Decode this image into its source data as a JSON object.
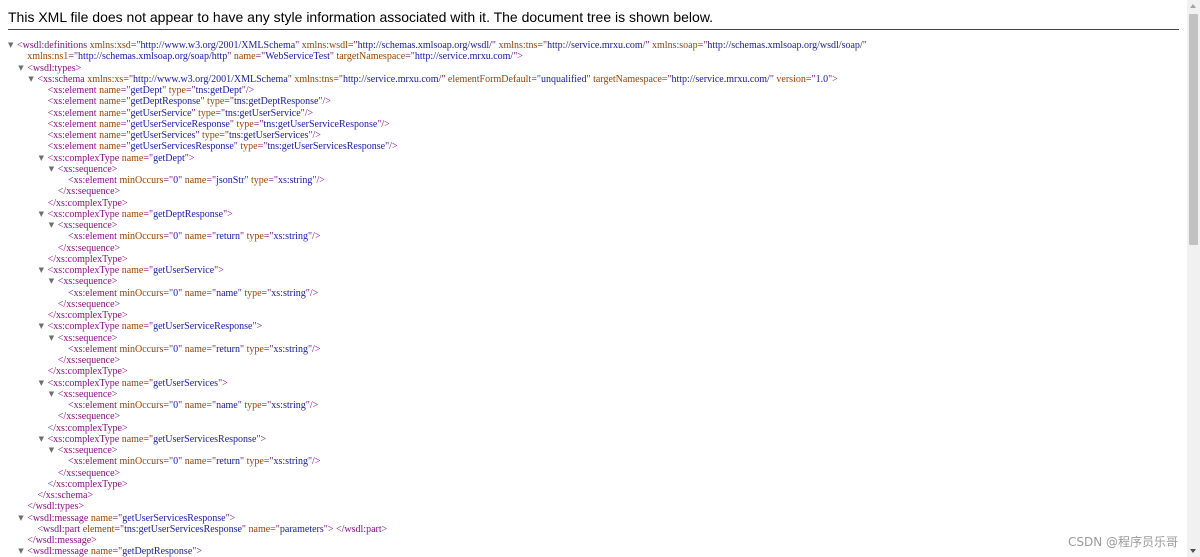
{
  "header": {
    "message": "This XML file does not appear to have any style information associated with it. The document tree is shown below."
  },
  "watermark": {
    "text": "CSDN @程序员乐哥"
  },
  "icons": {
    "expanded": "triangle-down-icon"
  },
  "lines": [
    {
      "indent": 0,
      "toggle": true,
      "parts": [
        [
          "t",
          "<wsdl:definitions "
        ],
        [
          "a",
          "xmlns:xsd"
        ],
        [
          "t",
          "=\""
        ],
        [
          "v",
          "http://www.w3.org/2001/XMLSchema"
        ],
        [
          "t",
          "\" "
        ],
        [
          "a",
          "xmlns:wsdl"
        ],
        [
          "t",
          "=\""
        ],
        [
          "v",
          "http://schemas.xmlsoap.org/wsdl/"
        ],
        [
          "t",
          "\" "
        ],
        [
          "a",
          "xmlns:tns"
        ],
        [
          "t",
          "=\""
        ],
        [
          "v",
          "http://service.mrxu.com/"
        ],
        [
          "t",
          "\" "
        ],
        [
          "a",
          "xmlns:soap"
        ],
        [
          "t",
          "=\""
        ],
        [
          "v",
          "http://schemas.xmlsoap.org/wsdl/soap/"
        ],
        [
          "t",
          "\""
        ]
      ]
    },
    {
      "indent": 1,
      "toggle": false,
      "parts": [
        [
          "a",
          "xmlns:ns1"
        ],
        [
          "t",
          "=\""
        ],
        [
          "v",
          "http://schemas.xmlsoap.org/soap/http"
        ],
        [
          "t",
          "\" "
        ],
        [
          "a",
          "name"
        ],
        [
          "t",
          "=\""
        ],
        [
          "v",
          "WebServiceTest"
        ],
        [
          "t",
          "\" "
        ],
        [
          "a",
          "targetNamespace"
        ],
        [
          "t",
          "=\""
        ],
        [
          "v",
          "http://service.mrxu.com/"
        ],
        [
          "t",
          "\">"
        ]
      ]
    },
    {
      "indent": 1,
      "toggle": true,
      "parts": [
        [
          "t",
          "<wsdl:types>"
        ]
      ]
    },
    {
      "indent": 2,
      "toggle": true,
      "parts": [
        [
          "t",
          "<xs:schema "
        ],
        [
          "a",
          "xmlns:xs"
        ],
        [
          "t",
          "=\""
        ],
        [
          "v",
          "http://www.w3.org/2001/XMLSchema"
        ],
        [
          "t",
          "\" "
        ],
        [
          "a",
          "xmlns:tns"
        ],
        [
          "t",
          "=\""
        ],
        [
          "v",
          "http://service.mrxu.com/"
        ],
        [
          "t",
          "\" "
        ],
        [
          "a",
          "elementFormDefault"
        ],
        [
          "t",
          "=\""
        ],
        [
          "v",
          "unqualified"
        ],
        [
          "t",
          "\" "
        ],
        [
          "a",
          "targetNamespace"
        ],
        [
          "t",
          "=\""
        ],
        [
          "v",
          "http://service.mrxu.com/"
        ],
        [
          "t",
          "\" "
        ],
        [
          "a",
          "version"
        ],
        [
          "t",
          "=\""
        ],
        [
          "v",
          "1.0"
        ],
        [
          "t",
          "\">"
        ]
      ]
    },
    {
      "indent": 3,
      "toggle": false,
      "parts": [
        [
          "t",
          "<xs:element "
        ],
        [
          "a",
          "name"
        ],
        [
          "t",
          "=\""
        ],
        [
          "v",
          "getDept"
        ],
        [
          "t",
          "\" "
        ],
        [
          "a",
          "type"
        ],
        [
          "t",
          "=\""
        ],
        [
          "v",
          "tns:getDept"
        ],
        [
          "t",
          "\"/>"
        ]
      ]
    },
    {
      "indent": 3,
      "toggle": false,
      "parts": [
        [
          "t",
          "<xs:element "
        ],
        [
          "a",
          "name"
        ],
        [
          "t",
          "=\""
        ],
        [
          "v",
          "getDeptResponse"
        ],
        [
          "t",
          "\" "
        ],
        [
          "a",
          "type"
        ],
        [
          "t",
          "=\""
        ],
        [
          "v",
          "tns:getDeptResponse"
        ],
        [
          "t",
          "\"/>"
        ]
      ]
    },
    {
      "indent": 3,
      "toggle": false,
      "parts": [
        [
          "t",
          "<xs:element "
        ],
        [
          "a",
          "name"
        ],
        [
          "t",
          "=\""
        ],
        [
          "v",
          "getUserService"
        ],
        [
          "t",
          "\" "
        ],
        [
          "a",
          "type"
        ],
        [
          "t",
          "=\""
        ],
        [
          "v",
          "tns:getUserService"
        ],
        [
          "t",
          "\"/>"
        ]
      ]
    },
    {
      "indent": 3,
      "toggle": false,
      "parts": [
        [
          "t",
          "<xs:element "
        ],
        [
          "a",
          "name"
        ],
        [
          "t",
          "=\""
        ],
        [
          "v",
          "getUserServiceResponse"
        ],
        [
          "t",
          "\" "
        ],
        [
          "a",
          "type"
        ],
        [
          "t",
          "=\""
        ],
        [
          "v",
          "tns:getUserServiceResponse"
        ],
        [
          "t",
          "\"/>"
        ]
      ]
    },
    {
      "indent": 3,
      "toggle": false,
      "parts": [
        [
          "t",
          "<xs:element "
        ],
        [
          "a",
          "name"
        ],
        [
          "t",
          "=\""
        ],
        [
          "v",
          "getUserServices"
        ],
        [
          "t",
          "\" "
        ],
        [
          "a",
          "type"
        ],
        [
          "t",
          "=\""
        ],
        [
          "v",
          "tns:getUserServices"
        ],
        [
          "t",
          "\"/>"
        ]
      ]
    },
    {
      "indent": 3,
      "toggle": false,
      "parts": [
        [
          "t",
          "<xs:element "
        ],
        [
          "a",
          "name"
        ],
        [
          "t",
          "=\""
        ],
        [
          "v",
          "getUserServicesResponse"
        ],
        [
          "t",
          "\" "
        ],
        [
          "a",
          "type"
        ],
        [
          "t",
          "=\""
        ],
        [
          "v",
          "tns:getUserServicesResponse"
        ],
        [
          "t",
          "\"/>"
        ]
      ]
    },
    {
      "indent": 3,
      "toggle": true,
      "parts": [
        [
          "t",
          "<xs:complexType "
        ],
        [
          "a",
          "name"
        ],
        [
          "t",
          "=\""
        ],
        [
          "v",
          "getDept"
        ],
        [
          "t",
          "\">"
        ]
      ]
    },
    {
      "indent": 4,
      "toggle": true,
      "parts": [
        [
          "t",
          "<xs:sequence>"
        ]
      ]
    },
    {
      "indent": 5,
      "toggle": false,
      "parts": [
        [
          "t",
          "<xs:element "
        ],
        [
          "a",
          "minOccurs"
        ],
        [
          "t",
          "=\""
        ],
        [
          "v",
          "0"
        ],
        [
          "t",
          "\" "
        ],
        [
          "a",
          "name"
        ],
        [
          "t",
          "=\""
        ],
        [
          "v",
          "jsonStr"
        ],
        [
          "t",
          "\" "
        ],
        [
          "a",
          "type"
        ],
        [
          "t",
          "=\""
        ],
        [
          "v",
          "xs:string"
        ],
        [
          "t",
          "\"/>"
        ]
      ]
    },
    {
      "indent": 4,
      "toggle": false,
      "parts": [
        [
          "t",
          "</xs:sequence>"
        ]
      ]
    },
    {
      "indent": 3,
      "toggle": false,
      "parts": [
        [
          "t",
          "</xs:complexType>"
        ]
      ]
    },
    {
      "indent": 3,
      "toggle": true,
      "parts": [
        [
          "t",
          "<xs:complexType "
        ],
        [
          "a",
          "name"
        ],
        [
          "t",
          "=\""
        ],
        [
          "v",
          "getDeptResponse"
        ],
        [
          "t",
          "\">"
        ]
      ]
    },
    {
      "indent": 4,
      "toggle": true,
      "parts": [
        [
          "t",
          "<xs:sequence>"
        ]
      ]
    },
    {
      "indent": 5,
      "toggle": false,
      "parts": [
        [
          "t",
          "<xs:element "
        ],
        [
          "a",
          "minOccurs"
        ],
        [
          "t",
          "=\""
        ],
        [
          "v",
          "0"
        ],
        [
          "t",
          "\" "
        ],
        [
          "a",
          "name"
        ],
        [
          "t",
          "=\""
        ],
        [
          "v",
          "return"
        ],
        [
          "t",
          "\" "
        ],
        [
          "a",
          "type"
        ],
        [
          "t",
          "=\""
        ],
        [
          "v",
          "xs:string"
        ],
        [
          "t",
          "\"/>"
        ]
      ]
    },
    {
      "indent": 4,
      "toggle": false,
      "parts": [
        [
          "t",
          "</xs:sequence>"
        ]
      ]
    },
    {
      "indent": 3,
      "toggle": false,
      "parts": [
        [
          "t",
          "</xs:complexType>"
        ]
      ]
    },
    {
      "indent": 3,
      "toggle": true,
      "parts": [
        [
          "t",
          "<xs:complexType "
        ],
        [
          "a",
          "name"
        ],
        [
          "t",
          "=\""
        ],
        [
          "v",
          "getUserService"
        ],
        [
          "t",
          "\">"
        ]
      ]
    },
    {
      "indent": 4,
      "toggle": true,
      "parts": [
        [
          "t",
          "<xs:sequence>"
        ]
      ]
    },
    {
      "indent": 5,
      "toggle": false,
      "parts": [
        [
          "t",
          "<xs:element "
        ],
        [
          "a",
          "minOccurs"
        ],
        [
          "t",
          "=\""
        ],
        [
          "v",
          "0"
        ],
        [
          "t",
          "\" "
        ],
        [
          "a",
          "name"
        ],
        [
          "t",
          "=\""
        ],
        [
          "v",
          "name"
        ],
        [
          "t",
          "\" "
        ],
        [
          "a",
          "type"
        ],
        [
          "t",
          "=\""
        ],
        [
          "v",
          "xs:string"
        ],
        [
          "t",
          "\"/>"
        ]
      ]
    },
    {
      "indent": 4,
      "toggle": false,
      "parts": [
        [
          "t",
          "</xs:sequence>"
        ]
      ]
    },
    {
      "indent": 3,
      "toggle": false,
      "parts": [
        [
          "t",
          "</xs:complexType>"
        ]
      ]
    },
    {
      "indent": 3,
      "toggle": true,
      "parts": [
        [
          "t",
          "<xs:complexType "
        ],
        [
          "a",
          "name"
        ],
        [
          "t",
          "=\""
        ],
        [
          "v",
          "getUserServiceResponse"
        ],
        [
          "t",
          "\">"
        ]
      ]
    },
    {
      "indent": 4,
      "toggle": true,
      "parts": [
        [
          "t",
          "<xs:sequence>"
        ]
      ]
    },
    {
      "indent": 5,
      "toggle": false,
      "parts": [
        [
          "t",
          "<xs:element "
        ],
        [
          "a",
          "minOccurs"
        ],
        [
          "t",
          "=\""
        ],
        [
          "v",
          "0"
        ],
        [
          "t",
          "\" "
        ],
        [
          "a",
          "name"
        ],
        [
          "t",
          "=\""
        ],
        [
          "v",
          "return"
        ],
        [
          "t",
          "\" "
        ],
        [
          "a",
          "type"
        ],
        [
          "t",
          "=\""
        ],
        [
          "v",
          "xs:string"
        ],
        [
          "t",
          "\"/>"
        ]
      ]
    },
    {
      "indent": 4,
      "toggle": false,
      "parts": [
        [
          "t",
          "</xs:sequence>"
        ]
      ]
    },
    {
      "indent": 3,
      "toggle": false,
      "parts": [
        [
          "t",
          "</xs:complexType>"
        ]
      ]
    },
    {
      "indent": 3,
      "toggle": true,
      "parts": [
        [
          "t",
          "<xs:complexType "
        ],
        [
          "a",
          "name"
        ],
        [
          "t",
          "=\""
        ],
        [
          "v",
          "getUserServices"
        ],
        [
          "t",
          "\">"
        ]
      ]
    },
    {
      "indent": 4,
      "toggle": true,
      "parts": [
        [
          "t",
          "<xs:sequence>"
        ]
      ]
    },
    {
      "indent": 5,
      "toggle": false,
      "parts": [
        [
          "t",
          "<xs:element "
        ],
        [
          "a",
          "minOccurs"
        ],
        [
          "t",
          "=\""
        ],
        [
          "v",
          "0"
        ],
        [
          "t",
          "\" "
        ],
        [
          "a",
          "name"
        ],
        [
          "t",
          "=\""
        ],
        [
          "v",
          "name"
        ],
        [
          "t",
          "\" "
        ],
        [
          "a",
          "type"
        ],
        [
          "t",
          "=\""
        ],
        [
          "v",
          "xs:string"
        ],
        [
          "t",
          "\"/>"
        ]
      ]
    },
    {
      "indent": 4,
      "toggle": false,
      "parts": [
        [
          "t",
          "</xs:sequence>"
        ]
      ]
    },
    {
      "indent": 3,
      "toggle": false,
      "parts": [
        [
          "t",
          "</xs:complexType>"
        ]
      ]
    },
    {
      "indent": 3,
      "toggle": true,
      "parts": [
        [
          "t",
          "<xs:complexType "
        ],
        [
          "a",
          "name"
        ],
        [
          "t",
          "=\""
        ],
        [
          "v",
          "getUserServicesResponse"
        ],
        [
          "t",
          "\">"
        ]
      ]
    },
    {
      "indent": 4,
      "toggle": true,
      "parts": [
        [
          "t",
          "<xs:sequence>"
        ]
      ]
    },
    {
      "indent": 5,
      "toggle": false,
      "parts": [
        [
          "t",
          "<xs:element "
        ],
        [
          "a",
          "minOccurs"
        ],
        [
          "t",
          "=\""
        ],
        [
          "v",
          "0"
        ],
        [
          "t",
          "\" "
        ],
        [
          "a",
          "name"
        ],
        [
          "t",
          "=\""
        ],
        [
          "v",
          "return"
        ],
        [
          "t",
          "\" "
        ],
        [
          "a",
          "type"
        ],
        [
          "t",
          "=\""
        ],
        [
          "v",
          "xs:string"
        ],
        [
          "t",
          "\"/>"
        ]
      ]
    },
    {
      "indent": 4,
      "toggle": false,
      "parts": [
        [
          "t",
          "</xs:sequence>"
        ]
      ]
    },
    {
      "indent": 3,
      "toggle": false,
      "parts": [
        [
          "t",
          "</xs:complexType>"
        ]
      ]
    },
    {
      "indent": 2,
      "toggle": false,
      "parts": [
        [
          "t",
          "</xs:schema>"
        ]
      ]
    },
    {
      "indent": 1,
      "toggle": false,
      "parts": [
        [
          "t",
          "</wsdl:types>"
        ]
      ]
    },
    {
      "indent": 1,
      "toggle": true,
      "parts": [
        [
          "t",
          "<wsdl:message "
        ],
        [
          "a",
          "name"
        ],
        [
          "t",
          "=\""
        ],
        [
          "v",
          "getUserServicesResponse"
        ],
        [
          "t",
          "\">"
        ]
      ]
    },
    {
      "indent": 2,
      "toggle": false,
      "parts": [
        [
          "t",
          "<wsdl:part "
        ],
        [
          "a",
          "element"
        ],
        [
          "t",
          "=\""
        ],
        [
          "v",
          "tns:getUserServicesResponse"
        ],
        [
          "t",
          "\" "
        ],
        [
          "a",
          "name"
        ],
        [
          "t",
          "=\""
        ],
        [
          "v",
          "parameters"
        ],
        [
          "t",
          "\"> </wsdl:part>"
        ]
      ]
    },
    {
      "indent": 1,
      "toggle": false,
      "parts": [
        [
          "t",
          "</wsdl:message>"
        ]
      ]
    },
    {
      "indent": 1,
      "toggle": true,
      "parts": [
        [
          "t",
          "<wsdl:message "
        ],
        [
          "a",
          "name"
        ],
        [
          "t",
          "=\""
        ],
        [
          "v",
          "getDeptResponse"
        ],
        [
          "t",
          "\">"
        ]
      ]
    }
  ]
}
